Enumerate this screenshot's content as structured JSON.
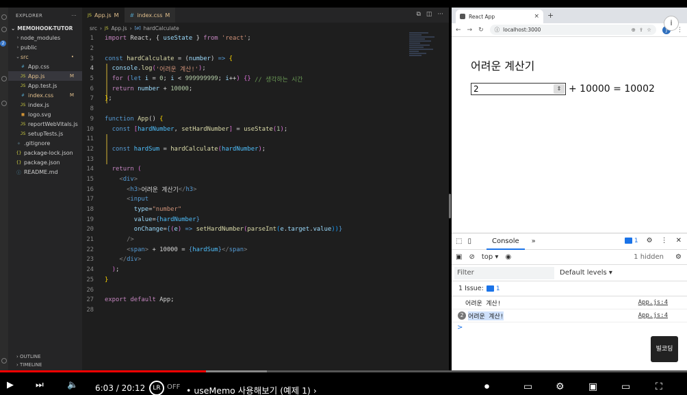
{
  "vscode": {
    "explorer_title": "EXPLORER",
    "explorer_more": "···",
    "project_name": "MEMOHOOK-TUTOR",
    "tree": [
      {
        "label": "node_modules",
        "type": "folder",
        "indent": 1,
        "open": false
      },
      {
        "label": "public",
        "type": "folder",
        "indent": 1,
        "open": false
      },
      {
        "label": "src",
        "type": "folder",
        "indent": 1,
        "open": true,
        "modified": true,
        "badge": "•"
      },
      {
        "label": "App.css",
        "type": "css",
        "indent": 2
      },
      {
        "label": "App.js",
        "type": "js",
        "indent": 2,
        "modified": true,
        "badge": "M",
        "selected": true
      },
      {
        "label": "App.test.js",
        "type": "js",
        "indent": 2
      },
      {
        "label": "index.css",
        "type": "css",
        "indent": 2,
        "modified": true,
        "badge": "M"
      },
      {
        "label": "index.js",
        "type": "js",
        "indent": 2
      },
      {
        "label": "logo.svg",
        "type": "svg",
        "indent": 2
      },
      {
        "label": "reportWebVitals.js",
        "type": "js",
        "indent": 2
      },
      {
        "label": "setupTests.js",
        "type": "js",
        "indent": 2
      },
      {
        "label": ".gitignore",
        "type": "git",
        "indent": 1
      },
      {
        "label": "package-lock.json",
        "type": "json",
        "indent": 1
      },
      {
        "label": "package.json",
        "type": "json",
        "indent": 1
      },
      {
        "label": "README.md",
        "type": "info",
        "indent": 1
      }
    ],
    "outline_label": "OUTLINE",
    "timeline_label": "TIMELINE",
    "activity_badge": "2",
    "tabs": [
      {
        "icon": "JS",
        "label": "App.js",
        "badge": "M",
        "active": true
      },
      {
        "icon": "#",
        "label": "index.css",
        "badge": "M",
        "active": false
      }
    ],
    "breadcrumb": {
      "folder": "src",
      "file_icon": "JS",
      "file": "App.js",
      "symbol_icon": "[ø]",
      "symbol": "hardCalculate"
    },
    "code_lines": [
      [
        {
          "t": "import",
          "c": "#c586c0"
        },
        {
          "t": " React, { ",
          "c": "#d4d4d4"
        },
        {
          "t": "useState",
          "c": "#9cdcfe"
        },
        {
          "t": " } ",
          "c": "#d4d4d4"
        },
        {
          "t": "from",
          "c": "#c586c0"
        },
        {
          "t": " ",
          "c": "#d4d4d4"
        },
        {
          "t": "'react'",
          "c": "#ce9178"
        },
        {
          "t": ";",
          "c": "#d4d4d4"
        }
      ],
      [],
      [
        {
          "t": "const ",
          "c": "#569cd6"
        },
        {
          "t": "hardCalculate",
          "c": "#dcdcaa"
        },
        {
          "t": " = (",
          "c": "#d4d4d4"
        },
        {
          "t": "number",
          "c": "#9cdcfe"
        },
        {
          "t": ") ",
          "c": "#d4d4d4"
        },
        {
          "t": "=>",
          "c": "#569cd6"
        },
        {
          "t": " {",
          "c": "#ffd700"
        }
      ],
      [
        {
          "t": "  console",
          "c": "#9cdcfe"
        },
        {
          "t": ".",
          "c": "#d4d4d4"
        },
        {
          "t": "log",
          "c": "#dcdcaa"
        },
        {
          "t": "(",
          "c": "#da70d6"
        },
        {
          "t": "'어려운 계산!'",
          "c": "#ce9178"
        },
        {
          "t": ")",
          "c": "#da70d6"
        },
        {
          "t": ";",
          "c": "#d4d4d4"
        }
      ],
      [
        {
          "t": "  ",
          "c": "#d4d4d4"
        },
        {
          "t": "for",
          "c": "#c586c0"
        },
        {
          "t": " (",
          "c": "#da70d6"
        },
        {
          "t": "let ",
          "c": "#569cd6"
        },
        {
          "t": "i",
          "c": "#9cdcfe"
        },
        {
          "t": " = ",
          "c": "#d4d4d4"
        },
        {
          "t": "0",
          "c": "#b5cea8"
        },
        {
          "t": "; ",
          "c": "#d4d4d4"
        },
        {
          "t": "i",
          "c": "#9cdcfe"
        },
        {
          "t": " < ",
          "c": "#d4d4d4"
        },
        {
          "t": "999999999",
          "c": "#b5cea8"
        },
        {
          "t": "; ",
          "c": "#d4d4d4"
        },
        {
          "t": "i",
          "c": "#9cdcfe"
        },
        {
          "t": "++",
          "c": "#d4d4d4"
        },
        {
          "t": ") ",
          "c": "#da70d6"
        },
        {
          "t": "{}",
          "c": "#da70d6"
        },
        {
          "t": " ",
          "c": "#d4d4d4"
        },
        {
          "t": "// 생각하는 시간",
          "c": "#6a9955"
        }
      ],
      [
        {
          "t": "  ",
          "c": "#d4d4d4"
        },
        {
          "t": "return",
          "c": "#c586c0"
        },
        {
          "t": " number",
          "c": "#9cdcfe"
        },
        {
          "t": " + ",
          "c": "#d4d4d4"
        },
        {
          "t": "10000",
          "c": "#b5cea8"
        },
        {
          "t": ";",
          "c": "#d4d4d4"
        }
      ],
      [
        {
          "t": "}",
          "c": "#ffd700"
        },
        {
          "t": ";",
          "c": "#d4d4d4"
        }
      ],
      [],
      [
        {
          "t": "function ",
          "c": "#569cd6"
        },
        {
          "t": "App",
          "c": "#dcdcaa"
        },
        {
          "t": "() ",
          "c": "#d4d4d4"
        },
        {
          "t": "{",
          "c": "#ffd700"
        }
      ],
      [
        {
          "t": "  ",
          "c": "#d4d4d4"
        },
        {
          "t": "const ",
          "c": "#569cd6"
        },
        {
          "t": "[",
          "c": "#da70d6"
        },
        {
          "t": "hardNumber",
          "c": "#4fc1ff"
        },
        {
          "t": ", ",
          "c": "#d4d4d4"
        },
        {
          "t": "setHardNumber",
          "c": "#dcdcaa"
        },
        {
          "t": "]",
          "c": "#da70d6"
        },
        {
          "t": " = ",
          "c": "#d4d4d4"
        },
        {
          "t": "useState",
          "c": "#dcdcaa"
        },
        {
          "t": "(",
          "c": "#da70d6"
        },
        {
          "t": "1",
          "c": "#b5cea8"
        },
        {
          "t": ")",
          "c": "#da70d6"
        },
        {
          "t": ";",
          "c": "#d4d4d4"
        }
      ],
      [],
      [
        {
          "t": "  ",
          "c": "#d4d4d4"
        },
        {
          "t": "const ",
          "c": "#569cd6"
        },
        {
          "t": "hardSum",
          "c": "#4fc1ff"
        },
        {
          "t": " = ",
          "c": "#d4d4d4"
        },
        {
          "t": "hardCalculate",
          "c": "#dcdcaa"
        },
        {
          "t": "(",
          "c": "#da70d6"
        },
        {
          "t": "hardNumber",
          "c": "#4fc1ff"
        },
        {
          "t": ")",
          "c": "#da70d6"
        },
        {
          "t": ";",
          "c": "#d4d4d4"
        }
      ],
      [],
      [
        {
          "t": "  ",
          "c": "#d4d4d4"
        },
        {
          "t": "return",
          "c": "#c586c0"
        },
        {
          "t": " (",
          "c": "#da70d6"
        }
      ],
      [
        {
          "t": "    ",
          "c": "#d4d4d4"
        },
        {
          "t": "<",
          "c": "#808080"
        },
        {
          "t": "div",
          "c": "#569cd6"
        },
        {
          "t": ">",
          "c": "#808080"
        }
      ],
      [
        {
          "t": "      ",
          "c": "#d4d4d4"
        },
        {
          "t": "<",
          "c": "#808080"
        },
        {
          "t": "h3",
          "c": "#569cd6"
        },
        {
          "t": ">",
          "c": "#808080"
        },
        {
          "t": "어려운 계산기",
          "c": "#d4d4d4"
        },
        {
          "t": "</",
          "c": "#808080"
        },
        {
          "t": "h3",
          "c": "#569cd6"
        },
        {
          "t": ">",
          "c": "#808080"
        }
      ],
      [
        {
          "t": "      ",
          "c": "#d4d4d4"
        },
        {
          "t": "<",
          "c": "#808080"
        },
        {
          "t": "input",
          "c": "#569cd6"
        }
      ],
      [
        {
          "t": "        ",
          "c": "#d4d4d4"
        },
        {
          "t": "type",
          "c": "#9cdcfe"
        },
        {
          "t": "=",
          "c": "#d4d4d4"
        },
        {
          "t": "\"number\"",
          "c": "#ce9178"
        }
      ],
      [
        {
          "t": "        ",
          "c": "#d4d4d4"
        },
        {
          "t": "value",
          "c": "#9cdcfe"
        },
        {
          "t": "=",
          "c": "#d4d4d4"
        },
        {
          "t": "{",
          "c": "#569cd6"
        },
        {
          "t": "hardNumber",
          "c": "#4fc1ff"
        },
        {
          "t": "}",
          "c": "#569cd6"
        }
      ],
      [
        {
          "t": "        ",
          "c": "#d4d4d4"
        },
        {
          "t": "onChange",
          "c": "#9cdcfe"
        },
        {
          "t": "=",
          "c": "#d4d4d4"
        },
        {
          "t": "{",
          "c": "#569cd6"
        },
        {
          "t": "(",
          "c": "#da70d6"
        },
        {
          "t": "e",
          "c": "#9cdcfe"
        },
        {
          "t": ")",
          "c": "#da70d6"
        },
        {
          "t": " => ",
          "c": "#569cd6"
        },
        {
          "t": "setHardNumber",
          "c": "#dcdcaa"
        },
        {
          "t": "(",
          "c": "#da70d6"
        },
        {
          "t": "parseInt",
          "c": "#dcdcaa"
        },
        {
          "t": "(",
          "c": "#179fff"
        },
        {
          "t": "e",
          "c": "#9cdcfe"
        },
        {
          "t": ".",
          "c": "#d4d4d4"
        },
        {
          "t": "target",
          "c": "#9cdcfe"
        },
        {
          "t": ".",
          "c": "#d4d4d4"
        },
        {
          "t": "value",
          "c": "#9cdcfe"
        },
        {
          "t": "))",
          "c": "#179fff"
        },
        {
          "t": "}",
          "c": "#569cd6"
        }
      ],
      [
        {
          "t": "      ",
          "c": "#d4d4d4"
        },
        {
          "t": "/>",
          "c": "#808080"
        }
      ],
      [
        {
          "t": "      ",
          "c": "#d4d4d4"
        },
        {
          "t": "<",
          "c": "#808080"
        },
        {
          "t": "span",
          "c": "#569cd6"
        },
        {
          "t": ">",
          "c": "#808080"
        },
        {
          "t": " + 10000 = ",
          "c": "#d4d4d4"
        },
        {
          "t": "{",
          "c": "#569cd6"
        },
        {
          "t": "hardSum",
          "c": "#4fc1ff"
        },
        {
          "t": "}",
          "c": "#569cd6"
        },
        {
          "t": "</",
          "c": "#808080"
        },
        {
          "t": "span",
          "c": "#569cd6"
        },
        {
          "t": ">",
          "c": "#808080"
        }
      ],
      [
        {
          "t": "    ",
          "c": "#d4d4d4"
        },
        {
          "t": "</",
          "c": "#808080"
        },
        {
          "t": "div",
          "c": "#569cd6"
        },
        {
          "t": ">",
          "c": "#808080"
        }
      ],
      [
        {
          "t": "  ",
          "c": "#d4d4d4"
        },
        {
          "t": ")",
          "c": "#da70d6"
        },
        {
          "t": ";",
          "c": "#d4d4d4"
        }
      ],
      [
        {
          "t": "}",
          "c": "#ffd700"
        }
      ],
      [],
      [
        {
          "t": "export",
          "c": "#c586c0"
        },
        {
          "t": " ",
          "c": "#d4d4d4"
        },
        {
          "t": "default",
          "c": "#c586c0"
        },
        {
          "t": " App;",
          "c": "#d4d4d4"
        }
      ],
      []
    ],
    "current_line": 4
  },
  "browser": {
    "tab_title": "React App",
    "url": "localhost:3000",
    "page_heading": "어려운 계산기",
    "input_value": "2",
    "sum_text": "+ 10000 = 10002",
    "profile_initial": "J"
  },
  "devtools": {
    "panel_tab": "Console",
    "more": "»",
    "issues_badge": "1",
    "context": "top ▾",
    "hidden": "1 hidden",
    "filter_placeholder": "Filter",
    "levels": "Default levels ▾",
    "issue_text": "1 Issue:",
    "issue_count": "1",
    "logs": [
      {
        "text": "어려운 계산!",
        "source": "App.js:4",
        "count": ""
      },
      {
        "text": "어려운 계산!",
        "source": "App.js:4",
        "count": "2",
        "highlight": true
      }
    ],
    "prompt": ">",
    "channel_badge": "빌코딩"
  },
  "player": {
    "time": "6:03 / 20:12",
    "autoplay_off": "OFF",
    "video_title": "• useMemo 사용해보기 (예제 1) ›",
    "progress_fraction": 0.3
  }
}
